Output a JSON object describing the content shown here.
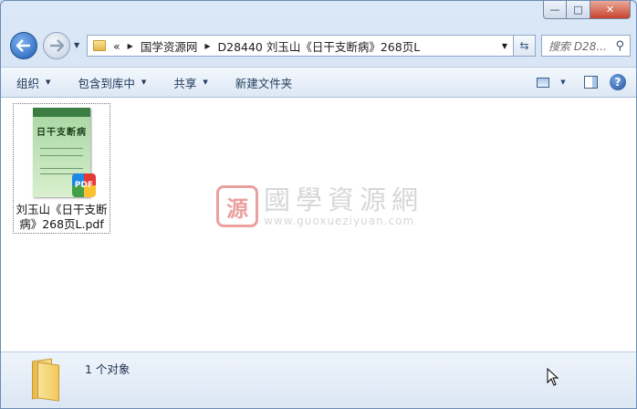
{
  "window": {
    "caption": {
      "minimize": "—",
      "maximize": "□",
      "close": "✕"
    }
  },
  "nav": {
    "breadcrumb_overflow": "«",
    "crumbs": [
      "国学资源网",
      "D28440 刘玉山《日干支断病》268页L"
    ],
    "search_placeholder": "搜索 D28..."
  },
  "toolbar": {
    "organize": "组织",
    "include_library": "包含到库中",
    "share": "共享",
    "new_folder": "新建文件夹"
  },
  "files": [
    {
      "name": "刘玉山《日干支断病》268页L.pdf",
      "thumbnail_title": "日干支断病",
      "badge": "PDF"
    }
  ],
  "watermark": {
    "logo": "源",
    "cn": "國學資源網",
    "en": "www.guoxueziyuan.com"
  },
  "status": {
    "count_text": "1 个对象"
  },
  "colors": {
    "accent": "#1d5db5",
    "toolbar_text": "#1e395b",
    "watermark_red": "#d9534f"
  }
}
